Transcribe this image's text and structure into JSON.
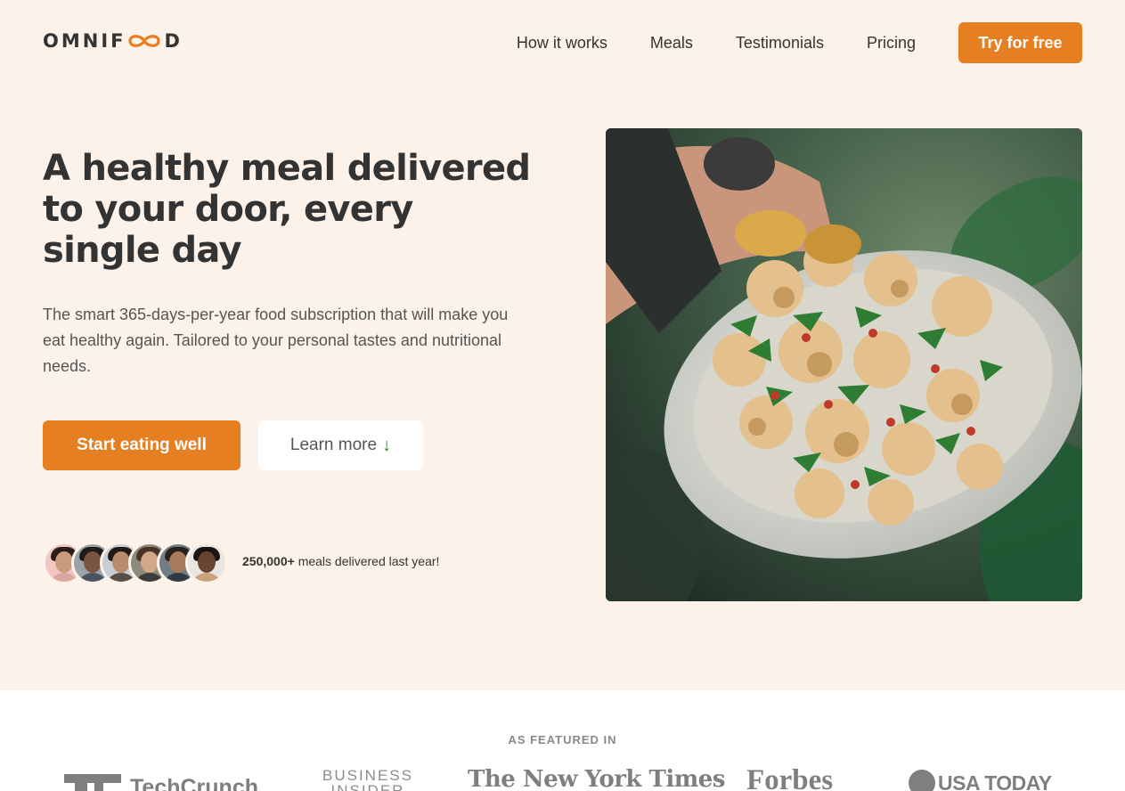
{
  "header": {
    "logo": {
      "pre": "OMNIF",
      "post": "D",
      "accent_color": "#e67e22"
    },
    "nav": [
      {
        "label": "How it works"
      },
      {
        "label": "Meals"
      },
      {
        "label": "Testimonials"
      },
      {
        "label": "Pricing"
      }
    ],
    "cta_label": "Try for free"
  },
  "hero": {
    "title": "A healthy meal delivered to your door, every single day",
    "description": "The smart 365-days-per-year food subscription that will make you eat healthy again. Tailored to your personal tastes and nutritional needs.",
    "primary_button": "Start eating well",
    "secondary_button": "Learn more",
    "secondary_icon": "↓",
    "delivered_count": "250,000+",
    "delivered_text": "meals delivered last year!"
  },
  "featured": {
    "label": "AS FEATURED IN",
    "logos": {
      "techcrunch": "TechCrunch",
      "business_insider_line1": "BUSINESS",
      "business_insider_line2": "INSIDER",
      "nyt": "The New York Times",
      "forbes": "Forbes",
      "usa_today": "USA TODAY"
    }
  },
  "colors": {
    "brand": "#e67e22",
    "hero_bg": "#fdf2e9",
    "text": "#333333"
  },
  "icons": {
    "arrow": "arrow-down-icon",
    "logo_mark": "infinity-icon"
  }
}
